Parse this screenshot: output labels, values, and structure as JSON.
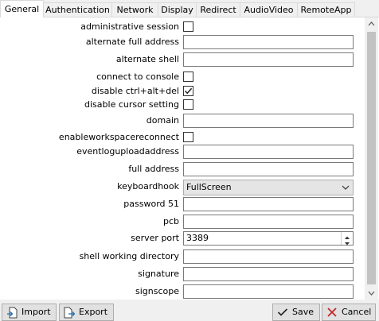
{
  "tabs": [
    {
      "label": "General",
      "active": true
    },
    {
      "label": "Authentication",
      "active": false
    },
    {
      "label": "Network",
      "active": false
    },
    {
      "label": "Display",
      "active": false
    },
    {
      "label": "Redirect",
      "active": false
    },
    {
      "label": "AudioVideo",
      "active": false
    },
    {
      "label": "RemoteApp",
      "active": false
    }
  ],
  "fields": [
    {
      "label": "administrative session",
      "type": "checkbox",
      "checked": false
    },
    {
      "label": "alternate full address",
      "type": "text",
      "value": ""
    },
    {
      "label": "alternate shell",
      "type": "text",
      "value": ""
    },
    {
      "label": "connect to console",
      "type": "checkbox",
      "checked": false
    },
    {
      "label": "disable ctrl+alt+del",
      "type": "checkbox",
      "checked": true
    },
    {
      "label": "disable cursor setting",
      "type": "checkbox",
      "checked": false
    },
    {
      "label": "domain",
      "type": "text",
      "value": ""
    },
    {
      "label": "enableworkspacereconnect",
      "type": "checkbox",
      "checked": false
    },
    {
      "label": "eventloguploadaddress",
      "type": "text",
      "value": ""
    },
    {
      "label": "full address",
      "type": "text",
      "value": ""
    },
    {
      "label": "keyboardhook",
      "type": "select",
      "value": "FullScreen"
    },
    {
      "label": "password 51",
      "type": "text",
      "value": ""
    },
    {
      "label": "pcb",
      "type": "text",
      "value": ""
    },
    {
      "label": "server port",
      "type": "spinner",
      "value": "3389"
    },
    {
      "label": "shell working directory",
      "type": "text",
      "value": ""
    },
    {
      "label": "signature",
      "type": "text",
      "value": ""
    },
    {
      "label": "signscope",
      "type": "text",
      "value": ""
    }
  ],
  "footer": {
    "import_label": "Import",
    "export_label": "Export",
    "save_label": "Save",
    "cancel_label": "Cancel"
  },
  "icons": {
    "import": "import-file-icon",
    "export": "export-file-icon",
    "save": "checkmark-icon",
    "cancel": "x-icon"
  },
  "colors": {
    "cancel_icon": "#c62828",
    "checkmark": "#222222"
  }
}
